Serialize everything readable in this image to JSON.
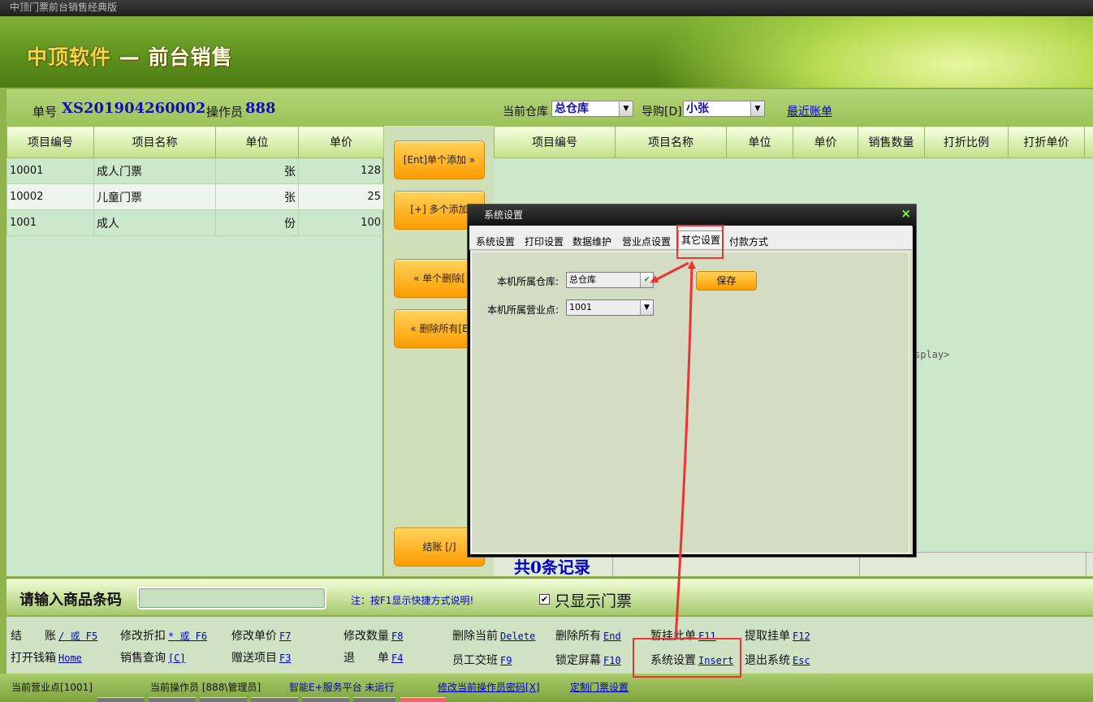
{
  "window": {
    "title": "中顶门票前台销售经典版"
  },
  "brand": {
    "part1": "中顶软件",
    "sep": " — ",
    "part2": "前台销售"
  },
  "info": {
    "order_label": "单号",
    "order_no": "XS201904260002",
    "operator_label": "操作员",
    "operator_no": "888",
    "warehouse_label": "当前仓库",
    "warehouse_value": "总仓库",
    "guide_label": "导购[D]",
    "guide_value": "小张",
    "recent_link": "最近账单"
  },
  "left_table": {
    "headers": [
      "项目编号",
      "项目名称",
      "单位",
      "单价"
    ],
    "rows": [
      [
        "10001",
        "成人门票",
        "张",
        "128"
      ],
      [
        "10002",
        "儿童门票",
        "张",
        "25"
      ],
      [
        "1001",
        "成人",
        "份",
        "100"
      ]
    ]
  },
  "mid_buttons": {
    "add_one": "[Ent]单个添加 »",
    "add_many": "[+] 多个添加",
    "delete_one": "« 单个删除[",
    "delete_all": "« 删除所有[E",
    "checkout": "结账 [/]"
  },
  "right_table": {
    "headers": [
      "项目编号",
      "项目名称",
      "单位",
      "单价",
      "销售数量",
      "打折比例",
      "打折单价"
    ],
    "records": "共0条记录",
    "display_text": "splay>"
  },
  "barcode": {
    "label": "请输入商品条码",
    "note": "注：按F1显示快捷方式说明!",
    "checkbox_mark": "✔",
    "checkbox_label": "只显示门票"
  },
  "shortcuts": [
    {
      "label": "结　　账",
      "key": "/ 或 F5"
    },
    {
      "label": "修改折扣",
      "key": "* 或 F6"
    },
    {
      "label": "修改单价",
      "key": "F7"
    },
    {
      "label": "修改数量",
      "key": "F8"
    },
    {
      "label": "删除当前",
      "key": "Delete"
    },
    {
      "label": "删除所有",
      "key": "End"
    },
    {
      "label": "暂挂此单",
      "key": "F11"
    },
    {
      "label": "提取挂单",
      "key": "F12"
    },
    {
      "label": "打开钱箱",
      "key": "Home"
    },
    {
      "label": "销售查询",
      "key": "[C]"
    },
    {
      "label": "赠送项目",
      "key": "F3"
    },
    {
      "label": "退　　单",
      "key": "F4"
    },
    {
      "label": "员工交班",
      "key": "F9"
    },
    {
      "label": "锁定屏幕",
      "key": "F10"
    },
    {
      "label": "系统设置",
      "key": "Insert"
    },
    {
      "label": "退出系统",
      "key": "Esc"
    }
  ],
  "status": {
    "branch": "当前营业点[1001]",
    "operator": "当前操作员 [888\\管理员]",
    "service": "智能E+服务平台 未运行",
    "change_pwd": "修改当前操作员密码[X]",
    "ticket_setup": "定制门票设置"
  },
  "dialog": {
    "title": "系统设置",
    "close": "×",
    "tabs": [
      "系统设置",
      "打印设置",
      "数据维护",
      "营业点设置",
      "其它设置",
      "付款方式"
    ],
    "active_tab": "其它设置",
    "warehouse_label": "本机所属仓库:",
    "warehouse_value": "总仓库",
    "branch_label": "本机所属营业点:",
    "branch_value": "1001",
    "save": "保存"
  },
  "colors": {
    "accent_orange": "#ff9c00",
    "link_blue": "#0000cc",
    "highlight_red": "#ee3333",
    "panel_green": "#cce8cc"
  }
}
